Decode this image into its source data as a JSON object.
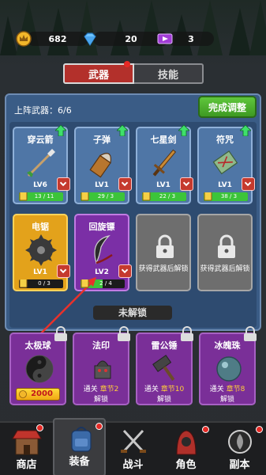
{
  "resources": {
    "crowns": "682",
    "gems": "20",
    "tickets": "3"
  },
  "tabs": [
    {
      "label": "武器"
    },
    {
      "label": "技能"
    }
  ],
  "lineup": {
    "label": "上阵武器：6/6",
    "done_button": "完成调整"
  },
  "weapons": [
    {
      "name": "穿云箭",
      "level": "LV6",
      "progress_text": "13 / 11",
      "progress": 1.0,
      "upgradable": true
    },
    {
      "name": "子弹",
      "level": "LV1",
      "progress_text": "29 / 3",
      "progress": 1.0,
      "upgradable": true
    },
    {
      "name": "七星剑",
      "level": "LV1",
      "progress_text": "22 / 3",
      "progress": 1.0,
      "upgradable": true
    },
    {
      "name": "符咒",
      "level": "LV1",
      "progress_text": "38 / 3",
      "progress": 1.0,
      "upgradable": true
    },
    {
      "name": "电锯",
      "level": "LV1",
      "progress_text": "0 / 3",
      "progress": 0.0,
      "upgradable": false
    },
    {
      "name": "回旋镖",
      "level": "LV2",
      "progress_text": "2 / 4",
      "progress": 0.5,
      "upgradable": false
    }
  ],
  "locked_slots": [
    {
      "text": "获得武器后解锁"
    },
    {
      "text": "获得武器后解锁"
    }
  ],
  "unlock_section": {
    "title": "未解锁",
    "items": [
      {
        "name": "太极球",
        "price": "2000"
      },
      {
        "name": "法印",
        "cond_prefix": "通关",
        "cond_chapter": "章节2",
        "cond_suffix": "解锁"
      },
      {
        "name": "雷公锤",
        "cond_prefix": "通关",
        "cond_chapter": "章节10",
        "cond_suffix": "解锁"
      },
      {
        "name": "冰魄珠",
        "cond_prefix": "通关",
        "cond_chapter": "章节8",
        "cond_suffix": "解锁"
      }
    ]
  },
  "nav": [
    {
      "label": "商店"
    },
    {
      "label": "装备"
    },
    {
      "label": "战斗"
    },
    {
      "label": "角色"
    },
    {
      "label": "副本"
    }
  ],
  "icons": {
    "crown": "crown-icon",
    "gem": "diamond-icon",
    "ticket": "ticket-icon",
    "arrow": "arrow-icon",
    "bullet": "bullet-icon",
    "sword": "sword-icon",
    "talisman": "talisman-icon",
    "saw": "saw-blade-icon",
    "boomerang": "boomerang-icon",
    "lock": "padlock-icon",
    "taiji": "yin-yang-icon",
    "seal": "seal-icon",
    "hammer": "hammer-icon",
    "ice": "ice-orb-icon"
  },
  "colors": {
    "panel": "#3a5c86",
    "active_tab": "#b3302b",
    "done_button": "#4fb02e",
    "gold_card": "#e3a21b",
    "purple_card": "#7b2fa6",
    "locked_card": "#6e6e6e",
    "price_text": "#c2141b"
  }
}
